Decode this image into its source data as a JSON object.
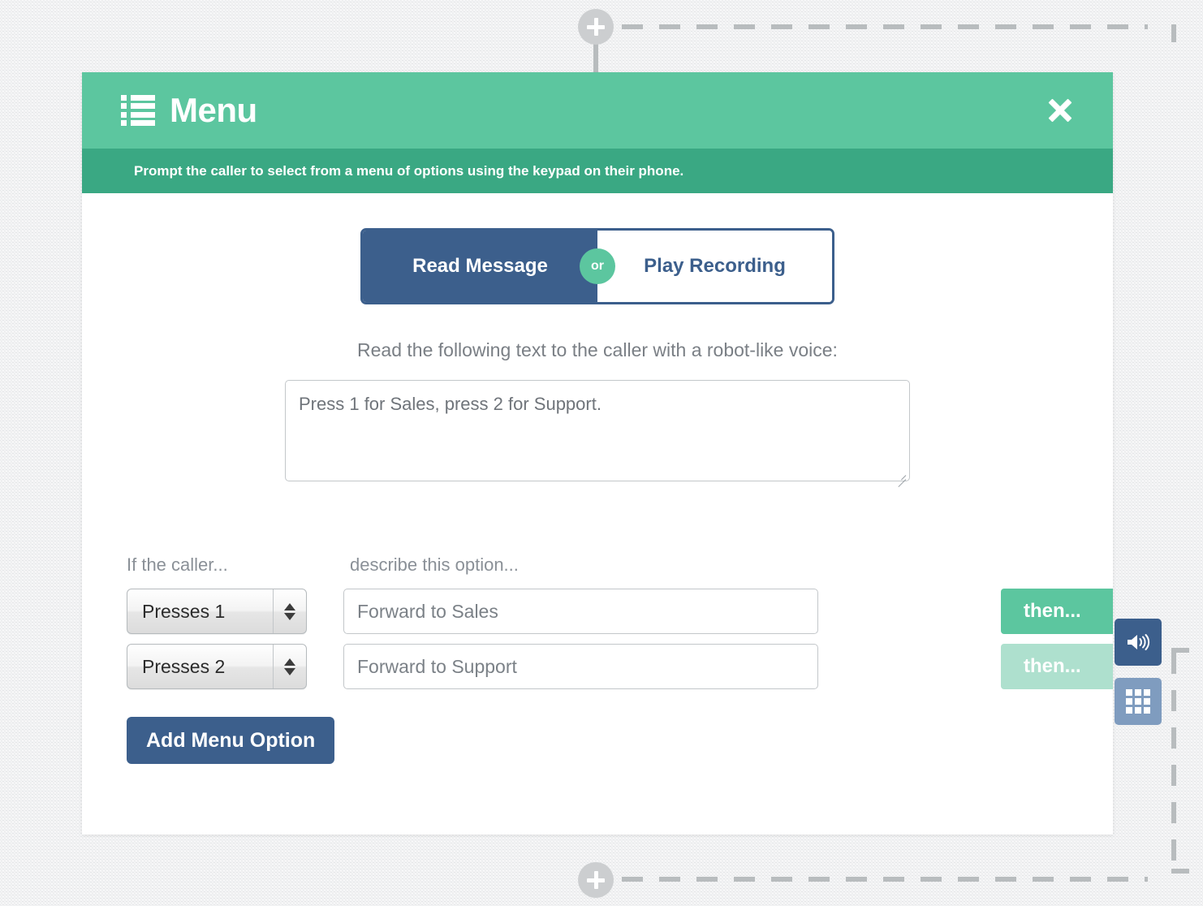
{
  "canvas": {
    "top_connector_icon": "plus-icon",
    "bottom_connector_icon": "plus-icon"
  },
  "modal": {
    "title": "Menu",
    "title_icon": "list-icon",
    "close_icon": "close-icon",
    "subtitle": "Prompt the caller to select from a menu of options using the keypad on their phone.",
    "header_color": "#5cc69f",
    "subtitle_color": "#3aa883",
    "accent_blue": "#3c5f8c"
  },
  "toggle": {
    "left_label": "Read Message",
    "separator_label": "or",
    "right_label": "Play Recording",
    "selected": "Read Message"
  },
  "message": {
    "label": "Read the following text to the caller with a robot-like voice:",
    "value": "Press 1 for Sales, press 2 for Support.",
    "placeholder": "Press 1 for Sales, press 2 for Support."
  },
  "options": {
    "header_condition": "If the caller...",
    "header_description": "describe this option...",
    "rows": [
      {
        "condition": "Presses 1",
        "description": "Forward to Sales",
        "description_placeholder": "Forward to Sales",
        "then_label": "then...",
        "then_icon": "speaker-icon",
        "then_state": "active"
      },
      {
        "condition": "Presses 2",
        "description": "Forward to Support",
        "description_placeholder": "Forward to Support",
        "then_label": "then...",
        "then_icon": "keypad-icon",
        "then_state": "inactive"
      }
    ],
    "add_button_label": "Add Menu Option"
  }
}
